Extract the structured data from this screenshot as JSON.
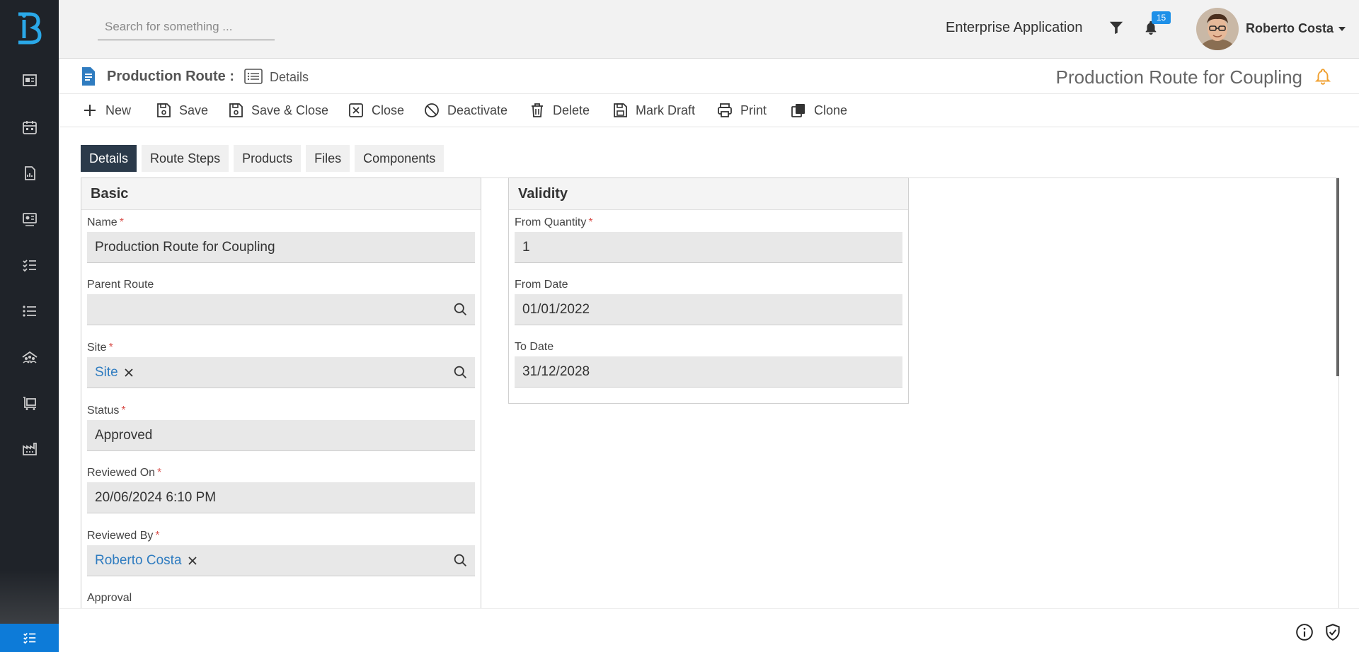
{
  "search": {
    "placeholder": "Search for something ..."
  },
  "header": {
    "app_name": "Enterprise Application",
    "notification_count": "15",
    "user_name": "Roberto Costa"
  },
  "breadcrumb": {
    "module": "Production Route :",
    "view": "Details",
    "record_title": "Production Route for Coupling"
  },
  "toolbar": {
    "new": "New",
    "save": "Save",
    "save_close": "Save & Close",
    "close": "Close",
    "deactivate": "Deactivate",
    "delete": "Delete",
    "mark_draft": "Mark Draft",
    "print": "Print",
    "clone": "Clone"
  },
  "tabs": [
    "Details",
    "Route Steps",
    "Products",
    "Files",
    "Components"
  ],
  "basic": {
    "title": "Basic",
    "name_label": "Name",
    "name_value": "Production Route for Coupling",
    "parent_route_label": "Parent Route",
    "site_label": "Site",
    "site_value": "Site",
    "status_label": "Status",
    "status_value": "Approved",
    "reviewed_on_label": "Reviewed On",
    "reviewed_on_value": "20/06/2024 6:10 PM",
    "reviewed_by_label": "Reviewed By",
    "reviewed_by_value": "Roberto Costa",
    "approval_label": "Approval"
  },
  "validity": {
    "title": "Validity",
    "from_quantity_label": "From Quantity",
    "from_quantity_value": "1",
    "from_date_label": "From Date",
    "from_date_value": "01/01/2022",
    "to_date_label": "To Date",
    "to_date_value": "31/12/2028"
  },
  "colors": {
    "sidebar_bg": "#1f2329",
    "accent_blue": "#0d7bd8",
    "active_tab": "#2b3a4a",
    "link": "#2f7cc0",
    "bell_orange": "#f0a030"
  }
}
